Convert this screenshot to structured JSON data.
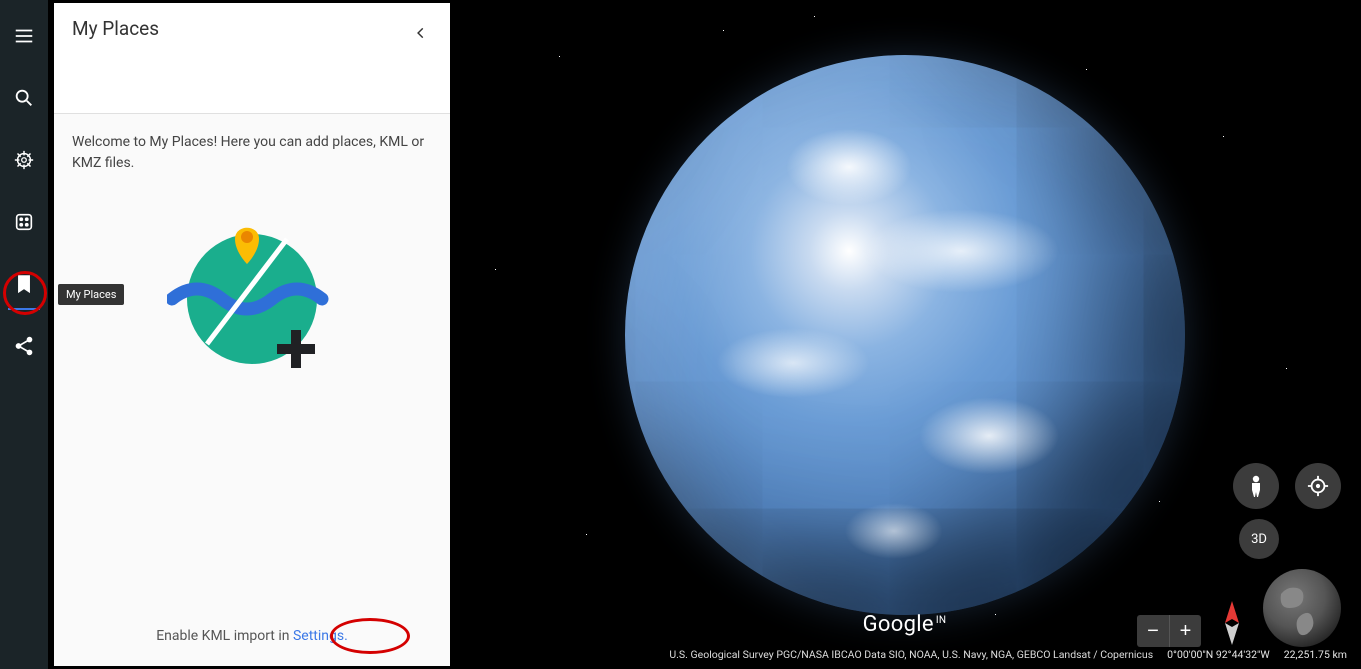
{
  "sidebar": {
    "menu_tip": "Menu",
    "search_tip": "Search",
    "voyager_tip": "Voyager",
    "lucky_tip": "I'm Feeling Lucky",
    "places_tip": "My Places",
    "share_tip": "Share"
  },
  "tooltip_myplaces": "My Places",
  "panel": {
    "title": "My Places",
    "welcome": "Welcome to My Places! Here you can add places, KML or KMZ files.",
    "footer_pre": "Enable KML import in ",
    "footer_link": "Settings."
  },
  "map": {
    "brand": "Google",
    "brand_sup": "IN",
    "attribution1": "U.S. Geological Survey   PGC/NASA   IBCAO   Data SIO, NOAA, U.S. Navy, NGA, GEBCO   Landsat / Copernicus",
    "coords": "0°00'00\"N 92°44'32\"W",
    "distance": "22,251.75 km",
    "threed_label": "3D"
  }
}
